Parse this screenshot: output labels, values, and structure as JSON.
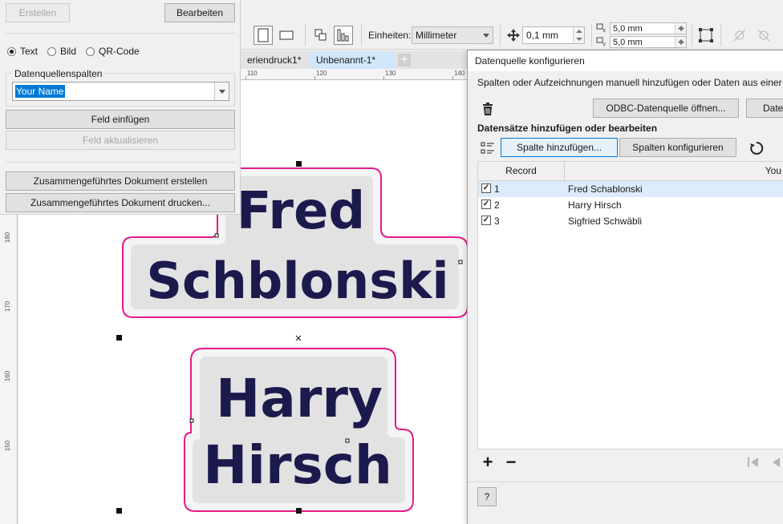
{
  "docker": {
    "create_button": "Erstellen",
    "edit_button": "Bearbeiten",
    "radio_options": [
      "Text",
      "Bild",
      "QR-Code"
    ],
    "selected_radio": "Text",
    "datasource_columns_label": "Datenquellenspalten",
    "selected_column": "Your Name",
    "insert_field_button": "Feld einfügen",
    "update_field_button": "Feld aktualisieren",
    "create_merged_button": "Zusammengeführtes Dokument erstellen",
    "print_merged_button": "Zusammengeführtes Dokument drucken..."
  },
  "toolbar": {
    "units_label": "Einheiten:",
    "units_value": "Millimeter",
    "nudge_value": "0,1 mm",
    "duplicate_x": "5,0 mm",
    "duplicate_y": "5,0 mm"
  },
  "doc_tabs": [
    "eriendruck1*",
    "Unbenannt-1*"
  ],
  "ruler": {
    "top": [
      "110",
      "120",
      "130",
      "140"
    ],
    "left": [
      "180",
      "170",
      "160",
      "150"
    ]
  },
  "canvas": {
    "label1": {
      "line1": "Fred",
      "line2": "Schblonski"
    },
    "label2": {
      "line1": "Harry",
      "line2": "Hirsch"
    },
    "text_color": "#1c1a4d",
    "outline_color": "#e6198a"
  },
  "dialog": {
    "title": "Datenquelle konfigurieren",
    "instruction": "Spalten oder Aufzeichnungen manuell hinzufügen oder Daten aus einer D",
    "odbc_button": "ODBC-Datenquelle öffnen...",
    "data_button": "Date",
    "section_title": "Datensätze hinzufügen oder bearbeiten",
    "add_column_button": "Spalte hinzufügen...",
    "configure_columns_button": "Spalten konfigurieren",
    "columns": [
      "Record",
      "You"
    ],
    "records": [
      {
        "num": "1",
        "name": "Fred Schablonski",
        "checked": true
      },
      {
        "num": "2",
        "name": "Harry Hirsch",
        "checked": true
      },
      {
        "num": "3",
        "name": "Sigfried Schwäbli",
        "checked": true
      }
    ],
    "add_icon": "+",
    "remove_icon": "−",
    "help_button": "?"
  }
}
